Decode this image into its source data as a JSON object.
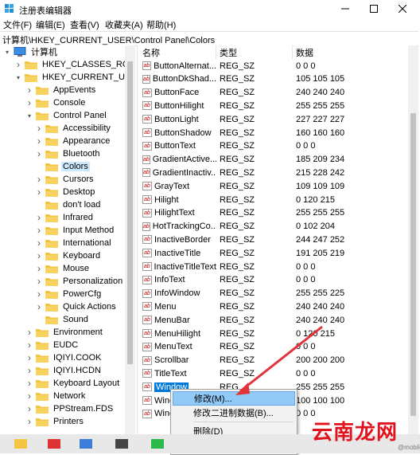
{
  "window": {
    "title": "注册表编辑器",
    "min_icon": "minimize-icon",
    "max_icon": "maximize-icon",
    "close_icon": "close-icon"
  },
  "menu": [
    "文件(F)",
    "编辑(E)",
    "查看(V)",
    "收藏夹(A)",
    "帮助(H)"
  ],
  "address": "计算机\\HKEY_CURRENT_USER\\Control Panel\\Colors",
  "tree": [
    {
      "label": "计算机",
      "expanded": true,
      "icon": "computer-icon"
    },
    {
      "label": "HKEY_CLASSES_ROOT",
      "expanded": false
    },
    {
      "label": "HKEY_CURRENT_USER",
      "expanded": true
    },
    {
      "label": "AppEvents",
      "expanded": false
    },
    {
      "label": "Console",
      "expanded": false
    },
    {
      "label": "Control Panel",
      "expanded": true
    },
    {
      "label": "Accessibility",
      "expanded": false
    },
    {
      "label": "Appearance",
      "expanded": false
    },
    {
      "label": "Bluetooth",
      "expanded": false
    },
    {
      "label": "Colors",
      "expanded": false,
      "selected": true
    },
    {
      "label": "Cursors",
      "expanded": false
    },
    {
      "label": "Desktop",
      "expanded": false
    },
    {
      "label": "don't load",
      "expanded": false
    },
    {
      "label": "Infrared",
      "expanded": false
    },
    {
      "label": "Input Method",
      "expanded": false
    },
    {
      "label": "International",
      "expanded": false
    },
    {
      "label": "Keyboard",
      "expanded": false
    },
    {
      "label": "Mouse",
      "expanded": false
    },
    {
      "label": "Personalization",
      "expanded": false
    },
    {
      "label": "PowerCfg",
      "expanded": false
    },
    {
      "label": "Quick Actions",
      "expanded": false
    },
    {
      "label": "Sound",
      "expanded": false
    },
    {
      "label": "Environment",
      "expanded": false
    },
    {
      "label": "EUDC",
      "expanded": false
    },
    {
      "label": "IQIYI.COOK",
      "expanded": false
    },
    {
      "label": "IQIYI.HCDN",
      "expanded": false
    },
    {
      "label": "Keyboard Layout",
      "expanded": false
    },
    {
      "label": "Network",
      "expanded": false
    },
    {
      "label": "PPStream.FDS",
      "expanded": false
    },
    {
      "label": "Printers",
      "expanded": false
    }
  ],
  "columns": [
    "名称",
    "类型",
    "数据"
  ],
  "values": [
    {
      "name": "ButtonAlternat...",
      "type": "REG_SZ",
      "data": "0 0 0"
    },
    {
      "name": "ButtonDkShad...",
      "type": "REG_SZ",
      "data": "105 105 105"
    },
    {
      "name": "ButtonFace",
      "type": "REG_SZ",
      "data": "240 240 240"
    },
    {
      "name": "ButtonHilight",
      "type": "REG_SZ",
      "data": "255 255 255"
    },
    {
      "name": "ButtonLight",
      "type": "REG_SZ",
      "data": "227 227 227"
    },
    {
      "name": "ButtonShadow",
      "type": "REG_SZ",
      "data": "160 160 160"
    },
    {
      "name": "ButtonText",
      "type": "REG_SZ",
      "data": "0 0 0"
    },
    {
      "name": "GradientActive...",
      "type": "REG_SZ",
      "data": "185 209 234"
    },
    {
      "name": "GradientInactiv...",
      "type": "REG_SZ",
      "data": "215 228 242"
    },
    {
      "name": "GrayText",
      "type": "REG_SZ",
      "data": "109 109 109"
    },
    {
      "name": "Hilight",
      "type": "REG_SZ",
      "data": "0 120 215"
    },
    {
      "name": "HilightText",
      "type": "REG_SZ",
      "data": "255 255 255"
    },
    {
      "name": "HotTrackingCo...",
      "type": "REG_SZ",
      "data": "0 102 204"
    },
    {
      "name": "InactiveBorder",
      "type": "REG_SZ",
      "data": "244 247 252"
    },
    {
      "name": "InactiveTitle",
      "type": "REG_SZ",
      "data": "191 205 219"
    },
    {
      "name": "InactiveTitleText",
      "type": "REG_SZ",
      "data": "0 0 0"
    },
    {
      "name": "InfoText",
      "type": "REG_SZ",
      "data": "0 0 0"
    },
    {
      "name": "InfoWindow",
      "type": "REG_SZ",
      "data": "255 255 225"
    },
    {
      "name": "Menu",
      "type": "REG_SZ",
      "data": "240 240 240"
    },
    {
      "name": "MenuBar",
      "type": "REG_SZ",
      "data": "240 240 240"
    },
    {
      "name": "MenuHilight",
      "type": "REG_SZ",
      "data": "0 120 215"
    },
    {
      "name": "MenuText",
      "type": "REG_SZ",
      "data": "0 0 0"
    },
    {
      "name": "Scrollbar",
      "type": "REG_SZ",
      "data": "200 200 200"
    },
    {
      "name": "TitleText",
      "type": "REG_SZ",
      "data": "0 0 0"
    },
    {
      "name": "Window",
      "type": "REG_",
      "data": "255 255 255",
      "selected": true
    },
    {
      "name": "Wind",
      "type": "",
      "data": "100 100 100"
    },
    {
      "name": "Wind",
      "type": "",
      "data": "0 0 0"
    }
  ],
  "context_menu": [
    {
      "label": "修改(M)...",
      "highlighted": true
    },
    {
      "label": "修改二进制数据(B)..."
    },
    {
      "separator": true
    },
    {
      "label": "删除(D)"
    },
    {
      "label": "重命名(R)"
    }
  ],
  "watermark": {
    "text": "云南龙网",
    "sub": "@mobile"
  },
  "colors": {
    "selection": "#0078d7",
    "tree_selection": "#cce8ff",
    "arrow": "#e2323a",
    "folder": "#f4c542"
  }
}
